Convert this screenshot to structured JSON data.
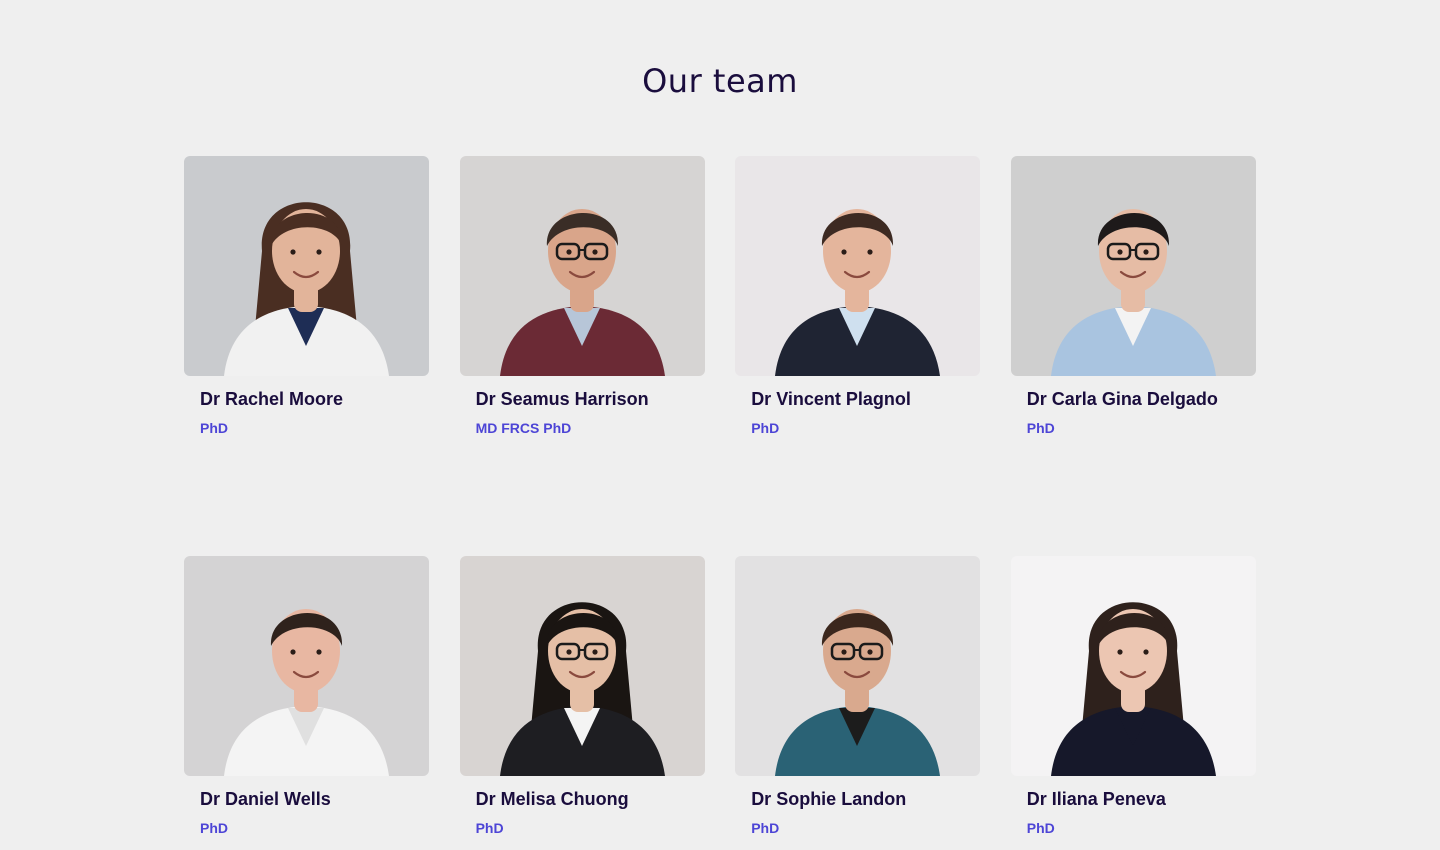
{
  "section": {
    "title": "Our team"
  },
  "team": [
    {
      "name": "Dr Rachel Moore",
      "credentials": "PhD",
      "bg": "#c9cbce",
      "hair": "#4a2e22",
      "skin": "#e2b49a",
      "top": "#f1f1f1",
      "accent": "#1e2d55",
      "glasses": false,
      "long_hair": true
    },
    {
      "name": "Dr Seamus Harrison",
      "credentials": "MD FRCS PhD",
      "bg": "#d6d4d3",
      "hair": "#3a2d26",
      "skin": "#d9a58a",
      "top": "#6b2a35",
      "accent": "#b7c6d8",
      "glasses": true,
      "long_hair": false
    },
    {
      "name": "Dr Vincent Plagnol",
      "credentials": "PhD",
      "bg": "#e9e6e8",
      "hair": "#3d2a22",
      "skin": "#e4b59c",
      "top": "#1f2433",
      "accent": "#cfe0ef",
      "glasses": false,
      "long_hair": false
    },
    {
      "name": "Dr Carla Gina Delgado",
      "credentials": "PhD",
      "bg": "#cfcfcf",
      "hair": "#1e1a1a",
      "skin": "#e6bca5",
      "top": "#a9c4e0",
      "accent": "#f3f3f3",
      "glasses": true,
      "long_hair": false
    },
    {
      "name": "Dr Daniel Wells",
      "credentials": "PhD",
      "bg": "#d4d3d4",
      "hair": "#2f221c",
      "skin": "#e8b7a2",
      "top": "#f4f4f4",
      "accent": "#e0e0e0",
      "glasses": false,
      "long_hair": false
    },
    {
      "name": "Dr Melisa Chuong",
      "credentials": "PhD",
      "bg": "#d8d4d2",
      "hair": "#1a1512",
      "skin": "#e5bfa6",
      "top": "#1e1e22",
      "accent": "#f4f4f4",
      "glasses": true,
      "long_hair": true
    },
    {
      "name": "Dr Sophie Landon",
      "credentials": "PhD",
      "bg": "#e2e1e2",
      "hair": "#3b271d",
      "skin": "#d9a98e",
      "top": "#2a6275",
      "accent": "#1c1c1c",
      "glasses": true,
      "long_hair": false
    },
    {
      "name": "Dr Iliana Peneva",
      "credentials": "PhD",
      "bg": "#f4f3f4",
      "hair": "#2e211c",
      "skin": "#ecc6b2",
      "top": "#16182a",
      "accent": "#16182a",
      "glasses": false,
      "long_hair": true
    }
  ]
}
